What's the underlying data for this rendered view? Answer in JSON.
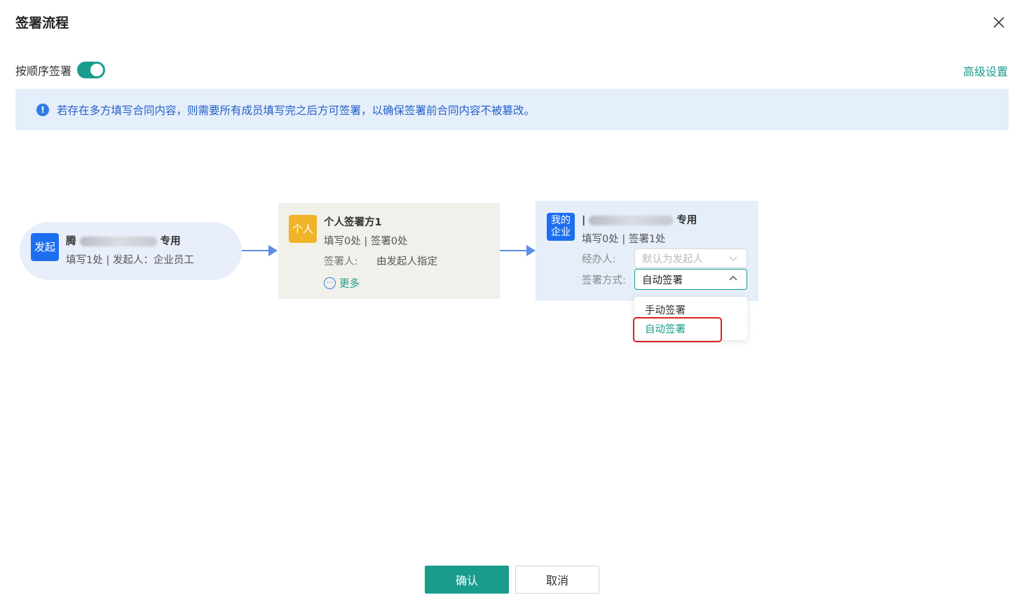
{
  "dialog": {
    "title": "签署流程",
    "close_icon": "close-icon"
  },
  "sequential": {
    "label": "按顺序签署",
    "enabled": true
  },
  "advanced_link": "高级设置",
  "notice": {
    "icon": "info-icon",
    "icon_glyph": "!",
    "text": "若存在多方填写合同内容，则需要所有成员填写完之后方可签署，以确保签署前合同内容不被篡改。"
  },
  "flow": {
    "initiator": {
      "badge": "发起",
      "name_prefix": "腾",
      "name_suffix": "专用",
      "subtitle": "填写1处 | 发起人：企业员工"
    },
    "personal": {
      "badge": "个人",
      "name": "个人签署方1",
      "subtitle": "填写0处 | 签署0处",
      "signer_label": "签署人:",
      "signer_value": "由发起人指定",
      "more_label": "更多"
    },
    "company": {
      "badge_line1": "我的",
      "badge_line2": "企业",
      "name_prefix": "|",
      "name_suffix": "专用",
      "subtitle": "填写0处 | 签署1处",
      "handler_label": "经办人:",
      "handler_placeholder": "默认为发起人",
      "method_label": "签署方式:",
      "method_value": "自动签署",
      "method_options": [
        "手动签署",
        "自动签署"
      ]
    }
  },
  "footer": {
    "confirm": "确认",
    "cancel": "取消"
  },
  "colors": {
    "accent": "#1a9c8c",
    "info_blue": "#2f7ee8",
    "highlight_red": "#e02020"
  }
}
